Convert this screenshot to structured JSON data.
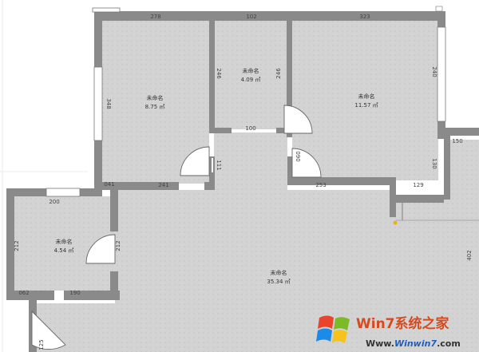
{
  "rooms": [
    {
      "name": "未命名",
      "area": "8.75 ㎡"
    },
    {
      "name": "未命名",
      "area": "4.09 ㎡"
    },
    {
      "name": "未命名",
      "area": "11.57 ㎡"
    },
    {
      "name": "未命名",
      "area": "4.54 ㎡"
    },
    {
      "name": "未命名",
      "area": "35.34 ㎡"
    }
  ],
  "dimensions": {
    "room1_top": "278",
    "room2_top": "102",
    "room3_top": "323",
    "room1_side": "348",
    "room2_left": "246",
    "room2_right": "246",
    "room3_right": "240",
    "room2_bottom": "100",
    "room1_bottom_a": "041",
    "room1_bottom_b": "241",
    "room1_door_side": "111",
    "room3_door_side": "090",
    "room3_bottom_a": "253",
    "room3_bottom_b": "129",
    "room3_corner": "150",
    "room3_right_lower": "130",
    "room4_top": "200",
    "room4_left": "212",
    "room4_right": "212",
    "room4_bottom_a": "062",
    "room4_bottom_b": "190",
    "living_right": "402",
    "living_left_bottom": "125"
  },
  "watermark": {
    "brand_cn": "Win7系统之家",
    "url_prefix": "Www.",
    "url_main": "Winwin7",
    "url_suffix": ".com"
  },
  "colors": {
    "floor": "#d4d4d4",
    "wall": "#8a8a8a",
    "wall_dark": "#6f6f6f",
    "window": "#ffffff"
  }
}
